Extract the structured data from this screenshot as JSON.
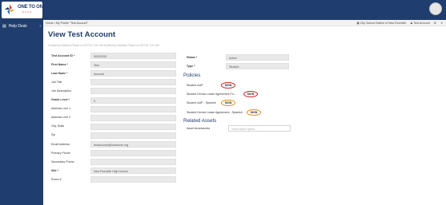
{
  "logo": {
    "text": "ONE TO ONE",
    "sub": "PLUS"
  },
  "sidebar": {
    "help_desk": "Help Desk",
    "chevron": "›"
  },
  "breadcrumb": {
    "text": "Home • My Profile \"Test Account\"",
    "district": "City School District of New Rochelle",
    "user": "Test Account"
  },
  "page": {
    "title": "View Test Account",
    "meta": "Created by Matthew Pelaez on 10/7/22, 5:37 AM    Modified by Matthew Pelaez on 10/7/22, 5:37 AM"
  },
  "form_left": [
    {
      "label": "Test Account ID *",
      "value": "00032939",
      "required": true
    },
    {
      "label": "First Name *",
      "value": "Test",
      "required": true
    },
    {
      "label": "Last Name *",
      "value": "Account",
      "required": true
    },
    {
      "label": "Job Title",
      "value": "",
      "required": false
    },
    {
      "label": "Job Description",
      "value": "",
      "required": false
    },
    {
      "label": "Grade Level *",
      "value": "3",
      "required": true
    },
    {
      "label": "Address Line 1",
      "value": "",
      "required": false
    },
    {
      "label": "Address Line 2",
      "value": "",
      "required": false
    },
    {
      "label": "City, State",
      "value": "",
      "required": false
    },
    {
      "label": "Zip",
      "value": "",
      "required": false
    },
    {
      "label": "Email Address",
      "value": "testaccount@onetoone.org",
      "required": false
    },
    {
      "label": "Primary Phone",
      "value": "",
      "required": false
    },
    {
      "label": "Secondary Phone",
      "value": "",
      "required": false
    },
    {
      "label": "Site *",
      "value": "New Rochelle High School",
      "required": true
    },
    {
      "label": "Room #",
      "value": "",
      "required": false
    }
  ],
  "form_right": [
    {
      "label": "Status *",
      "value": "Active"
    },
    {
      "label": "Type *",
      "value": "Student"
    }
  ],
  "policies": {
    "heading": "Policies",
    "items": [
      {
        "label": "Student AUP",
        "button": "SIGN",
        "ring": "red"
      },
      {
        "label": "Student Device Lease Agreement Fo...",
        "button": "SIGN",
        "ring": "red"
      },
      {
        "label": "Student AUP - Spanish",
        "button": "SIGN",
        "ring": "orange"
      },
      {
        "label": "Student Device Lease Agreement - Spanish",
        "button": "SIGN",
        "ring": "orange"
      }
    ]
  },
  "related_assets": {
    "heading": "Related Assets",
    "label": "Asset Accessories",
    "placeholder": "Select Asset Options"
  },
  "colors": {
    "brand": "#1f3d6e",
    "sign_red": "#cc2222",
    "sign_orange": "#e08a1e"
  }
}
